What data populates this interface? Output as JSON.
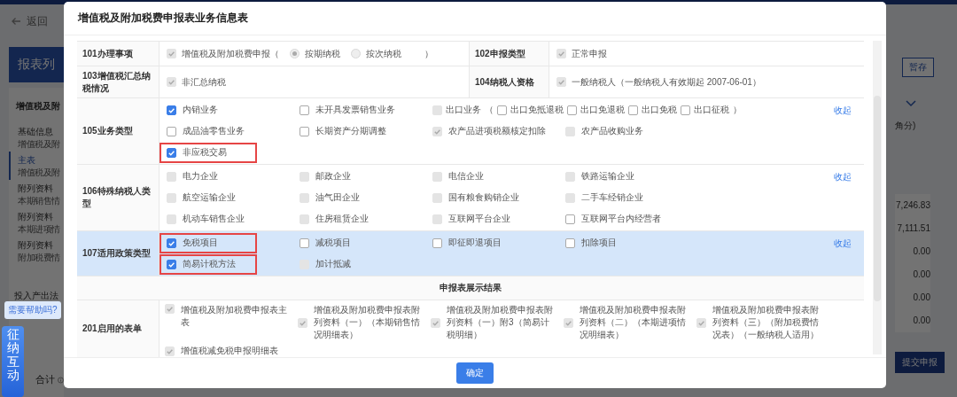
{
  "background": {
    "back_link": "返回",
    "list_title": "报表列",
    "section_title": "增值税及附",
    "sidebar_items": [
      {
        "title": "基础信息",
        "subtitle": "增值税及附",
        "selected": false
      },
      {
        "title": "主表",
        "subtitle": "增值税及附",
        "selected": true
      },
      {
        "title": "附列资料",
        "subtitle": "本期销售情",
        "selected": false
      },
      {
        "title": "附列资料",
        "subtitle": "本期进项情",
        "selected": false
      },
      {
        "title": "附列资料",
        "subtitle": "附加税费情",
        "selected": false
      }
    ],
    "extra_item": "投入产出法",
    "total_label": "合计",
    "help_tooltip": "需要帮助吗?",
    "help_button": "征纳互动",
    "save_button": "暂存",
    "unit_note": "角分)",
    "amounts": [
      "7,246.83",
      "7,111.51",
      "0.00",
      "0.00",
      "0.00",
      "0.00"
    ],
    "submit_button": "提交申报"
  },
  "dialog": {
    "title": "增值税及附加税费申报表业务信息表",
    "basic_rows": [
      {
        "left": {
          "label": "101办理事项",
          "check": {
            "text": "增值税及附加税费申报（",
            "checked": true,
            "disabled": true
          },
          "radios": [
            {
              "label": "按期纳税",
              "selected": true
            },
            {
              "label": "按次纳税",
              "selected": false
            }
          ],
          "close_paren": "）"
        },
        "right": {
          "label": "102申报类型",
          "check": {
            "text": "正常申报",
            "checked": true,
            "disabled": true
          }
        }
      },
      {
        "left": {
          "label": "103增值税汇总纳税情况",
          "check": {
            "text": "非汇总纳税",
            "checked": true,
            "disabled": true
          }
        },
        "right": {
          "label": "104纳税人资格",
          "check": {
            "text": "一般纳税人（一般纳税人有效期起 2007-06-01）",
            "checked": true,
            "disabled": true
          }
        }
      }
    ],
    "option_rows": [
      {
        "label": "105业务类型",
        "selected": false,
        "collapse_link": "收起",
        "options": [
          {
            "text": "内销业务",
            "checked": true,
            "disabled": false,
            "marked": false
          },
          {
            "text": "未开具发票销售业务",
            "checked": false,
            "disabled": false,
            "marked": false
          },
          {
            "text": "出口业务",
            "checked": false,
            "disabled": true,
            "marked": false,
            "sub_open": "（",
            "sub_close": "）",
            "sub_options": [
              {
                "text": "出口免抵退税",
                "checked": false,
                "disabled": false
              },
              {
                "text": "出口免退税",
                "checked": false,
                "disabled": false
              },
              {
                "text": "出口免税",
                "checked": false,
                "disabled": false
              },
              {
                "text": "出口征税",
                "checked": false,
                "disabled": false
              }
            ]
          },
          {
            "text": "成品油零售业务",
            "checked": false,
            "disabled": false,
            "marked": false
          },
          {
            "text": "长期资产分期调整",
            "checked": false,
            "disabled": false,
            "marked": false
          },
          {
            "text": "农产品进项税额核定扣除",
            "checked": true,
            "disabled": true,
            "marked": false
          },
          {
            "text": "农产品收购业务",
            "checked": false,
            "disabled": true,
            "marked": false
          },
          {
            "text": "非应税交易",
            "checked": true,
            "disabled": false,
            "marked": true
          }
        ]
      },
      {
        "label": "106特殊纳税人类型",
        "selected": false,
        "collapse_link": "收起",
        "options": [
          {
            "text": "电力企业",
            "checked": false,
            "disabled": true,
            "marked": false
          },
          {
            "text": "邮政企业",
            "checked": false,
            "disabled": true,
            "marked": false
          },
          {
            "text": "电信企业",
            "checked": false,
            "disabled": true,
            "marked": false
          },
          {
            "text": "铁路运输企业",
            "checked": false,
            "disabled": true,
            "marked": false
          },
          {
            "text": "航空运输企业",
            "checked": false,
            "disabled": true,
            "marked": false
          },
          {
            "text": "油气田企业",
            "checked": false,
            "disabled": true,
            "marked": false
          },
          {
            "text": "国有粮食购销企业",
            "checked": false,
            "disabled": true,
            "marked": false
          },
          {
            "text": "二手车经销企业",
            "checked": false,
            "disabled": true,
            "marked": false
          },
          {
            "text": "机动车销售企业",
            "checked": false,
            "disabled": true,
            "marked": false
          },
          {
            "text": "住房租赁企业",
            "checked": false,
            "disabled": true,
            "marked": false
          },
          {
            "text": "互联网平台企业",
            "checked": false,
            "disabled": true,
            "marked": false
          },
          {
            "text": "互联网平台内经营者",
            "checked": false,
            "disabled": false,
            "marked": false
          }
        ]
      },
      {
        "label": "107适用政策类型",
        "selected": true,
        "collapse_link": "收起",
        "options": [
          {
            "text": "免税项目",
            "checked": true,
            "disabled": false,
            "marked": true
          },
          {
            "text": "减税项目",
            "checked": false,
            "disabled": false,
            "marked": false
          },
          {
            "text": "即征即退项目",
            "checked": false,
            "disabled": false,
            "marked": false
          },
          {
            "text": "扣除项目",
            "checked": false,
            "disabled": false,
            "marked": false
          },
          {
            "text": "简易计税方法",
            "checked": true,
            "disabled": false,
            "marked": true
          },
          {
            "text": "加计抵减",
            "checked": false,
            "disabled": true,
            "marked": false
          }
        ]
      }
    ],
    "results_header": "申报表展示结果",
    "result_rows": [
      {
        "label": "201启用的表单",
        "forms": [
          {
            "text": "增值税及附加税费申报表主表",
            "checked": true,
            "disabled": true
          },
          {
            "text": "增值税及附加税费申报表附列资料（一）（本期销售情况明细表）",
            "checked": true,
            "disabled": true
          },
          {
            "text": "增值税及附加税费申报表附列资料（一）附3（简易计税明细）",
            "checked": true,
            "disabled": true
          },
          {
            "text": "增值税及附加税费申报表附列资料（二）（本期进项情况明细表）",
            "checked": true,
            "disabled": true
          },
          {
            "text": "增值税及附加税费申报表附列资料（三）（附加税费情况表）（一般纳税人适用）",
            "checked": true,
            "disabled": true
          },
          {
            "text": "增值税减免税申报明细表",
            "checked": true,
            "disabled": true
          }
        ]
      }
    ],
    "confirm_button": "确定"
  }
}
